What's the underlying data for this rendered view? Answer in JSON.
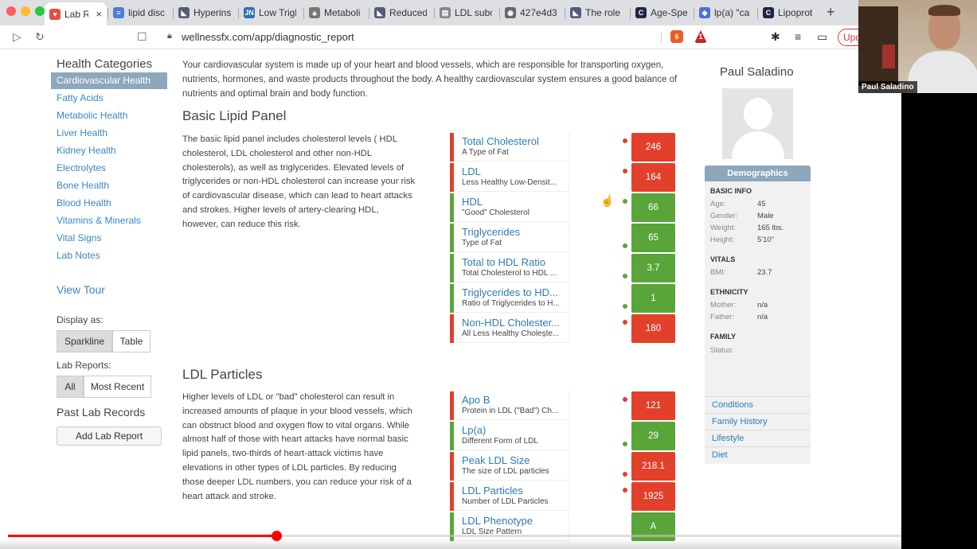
{
  "browser": {
    "tabs": [
      {
        "label": "Lab Re",
        "icon": "heart-icon",
        "color": "#e0533e"
      },
      {
        "label": "lipid disc",
        "icon": "docs-icon",
        "color": "#4a7fd8"
      },
      {
        "label": "Hyperins",
        "icon": "bookmark-icon",
        "color": "#555a7c"
      },
      {
        "label": "Low Trigl",
        "icon": "jn-icon",
        "color": "#2d6fb5"
      },
      {
        "label": "Metaboli",
        "icon": "lock-icon",
        "color": "#777777"
      },
      {
        "label": "Reduced",
        "icon": "bookmark-icon",
        "color": "#555a7c"
      },
      {
        "label": "LDL subc",
        "icon": "doc-icon",
        "color": "#888888"
      },
      {
        "label": "427e4d3",
        "icon": "globe-icon",
        "color": "#666666"
      },
      {
        "label": "The role",
        "icon": "bookmark-icon",
        "color": "#555a7c"
      },
      {
        "label": "Age-Spe",
        "icon": "c-icon",
        "color": "#222244"
      },
      {
        "label": "lp(a) \"ca",
        "icon": "diamond-icon",
        "color": "#4a6fd8"
      },
      {
        "label": "Lipoprot",
        "icon": "c-icon",
        "color": "#222244"
      }
    ],
    "url": "wellnessfx.com/app/diagnostic_report",
    "update_label": "Upd",
    "brave_badge": "6",
    "alert_badge": "1"
  },
  "webcam": {
    "name": "Paul Saladino"
  },
  "sidebar": {
    "title": "Health Categories",
    "items": [
      "Cardiovascular Health",
      "Fatty Acids",
      "Metabolic Health",
      "Liver Health",
      "Kidney Health",
      "Electrolytes",
      "Bone Health",
      "Blood Health",
      "Vitamins & Minerals",
      "Vital Signs",
      "Lab Notes"
    ],
    "view_tour": "View Tour",
    "display_as_label": "Display as:",
    "display_options": [
      "Sparkline",
      "Table"
    ],
    "lab_reports_label": "Lab Reports:",
    "lab_report_options": [
      "All",
      "Most Recent"
    ],
    "past_records_label": "Past Lab Records",
    "add_lab_report": "Add Lab Report"
  },
  "main": {
    "intro": "Your cardiovascular system is made up of your heart and blood vessels, which are responsible for transporting oxygen, nutrients, hormones, and waste products throughout the body. A healthy cardiovascular system ensures a good balance of nutrients and optimal brain and body function.",
    "sections": [
      {
        "title": "Basic Lipid Panel",
        "description": "The basic lipid panel includes cholesterol levels ( HDL cholesterol, LDL cholesterol and other non-HDL cholesterols), as well as triglycerides. Elevated levels of triglycerides or non-HDL cholesterol can increase your risk of cardiovascular disease, which can lead to heart attacks and strokes. Higher levels of artery-clearing HDL, however, can reduce this risk.",
        "biomarkers": [
          {
            "name": "Total Cholesterol",
            "desc": "A Type of Fat",
            "value": "246",
            "status": "high",
            "dot_level": "top"
          },
          {
            "name": "LDL",
            "desc": "Less Healthy Low-Densit...",
            "value": "164",
            "status": "high",
            "dot_level": "top"
          },
          {
            "name": "HDL",
            "desc": "\"Good\" Cholesterol",
            "value": "66",
            "status": "normal",
            "dot_level": "top"
          },
          {
            "name": "Triglycerides",
            "desc": "Type of Fat",
            "value": "65",
            "status": "normal",
            "dot_level": "bottom"
          },
          {
            "name": "Total to HDL Ratio",
            "desc": "Total Cholesterol to HDL ...",
            "value": "3.7",
            "status": "normal",
            "dot_level": "bottom"
          },
          {
            "name": "Triglycerides to HD...",
            "desc": "Ratio of Triglycerides to H...",
            "value": "1",
            "status": "normal",
            "dot_level": "bottom"
          },
          {
            "name": "Non-HDL Cholester...",
            "desc": "All Less Healthy Cholește...",
            "value": "180",
            "status": "high",
            "dot_level": "top"
          }
        ]
      },
      {
        "title": "LDL Particles",
        "description": "Higher levels of LDL or \"bad\" cholesterol can result in increased amounts of plaque in your blood vessels, which can obstruct blood and oxygen flow to vital organs. While almost half of those with heart attacks have normal basic lipid panels, two-thirds of heart-attack victims have elevations in other types of LDL particles. By reducing those deeper LDL numbers, you can reduce your risk of a heart attack and stroke.",
        "biomarkers": [
          {
            "name": "Apo B",
            "desc": "Protein in LDL (\"Bad\") Ch...",
            "value": "121",
            "status": "high",
            "dot_level": "top"
          },
          {
            "name": "Lp(a)",
            "desc": "Different Form of LDL",
            "value": "29",
            "status": "normal",
            "dot_level": "bottom"
          },
          {
            "name": "Peak LDL Size",
            "desc": "The size of LDL particles",
            "value": "218.1",
            "status": "high",
            "dot_level": "bottom"
          },
          {
            "name": "LDL Particles",
            "desc": "Number of LDL Particles",
            "value": "1925",
            "status": "high",
            "dot_level": "top"
          },
          {
            "name": "LDL Phenotype",
            "desc": "LDL Size Pattern",
            "value": "A",
            "status": "normal",
            "dot_level": "none"
          }
        ]
      }
    ]
  },
  "profile": {
    "name": "Paul Saladino",
    "demographics_title": "Demographics",
    "basic_info_label": "BASIC INFO",
    "basic_info": [
      {
        "k": "Age:",
        "v": "45"
      },
      {
        "k": "Gender:",
        "v": "Male"
      },
      {
        "k": "Weight:",
        "v": "165 lbs."
      },
      {
        "k": "Height:",
        "v": "5'10\""
      }
    ],
    "vitals_label": "VITALS",
    "vitals": [
      {
        "k": "BMI:",
        "v": "23.7"
      }
    ],
    "ethnicity_label": "ETHNICITY",
    "ethnicity": [
      {
        "k": "Mother:",
        "v": "n/a"
      },
      {
        "k": "Father:",
        "v": "n/a"
      }
    ],
    "family_label": "FAMILY",
    "family": [
      {
        "k": "Status:",
        "v": ""
      }
    ],
    "links": [
      "Conditions",
      "Family History",
      "Lifestyle",
      "Diet"
    ]
  },
  "video": {
    "progress": 0.3
  },
  "colors": {
    "high": "#e2402b",
    "normal": "#5aa53a",
    "accent": "#8da7bd",
    "link": "#3a87c6"
  }
}
